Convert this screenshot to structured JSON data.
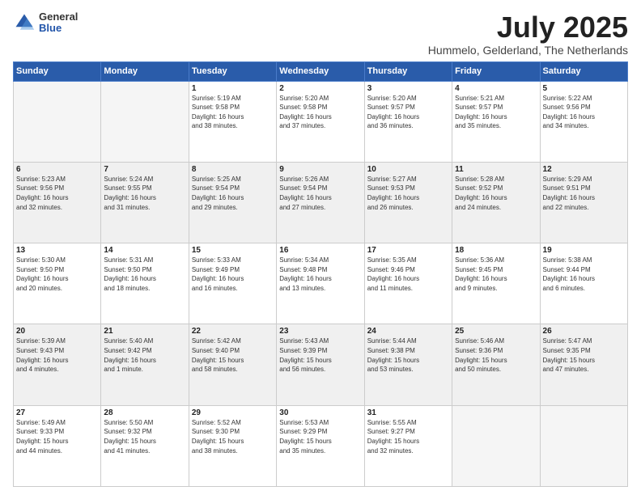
{
  "logo": {
    "general": "General",
    "blue": "Blue"
  },
  "title": "July 2025",
  "subtitle": "Hummelo, Gelderland, The Netherlands",
  "headers": [
    "Sunday",
    "Monday",
    "Tuesday",
    "Wednesday",
    "Thursday",
    "Friday",
    "Saturday"
  ],
  "weeks": [
    [
      {
        "day": "",
        "info": "",
        "empty": true
      },
      {
        "day": "",
        "info": "",
        "empty": true
      },
      {
        "day": "1",
        "info": "Sunrise: 5:19 AM\nSunset: 9:58 PM\nDaylight: 16 hours\nand 38 minutes."
      },
      {
        "day": "2",
        "info": "Sunrise: 5:20 AM\nSunset: 9:58 PM\nDaylight: 16 hours\nand 37 minutes."
      },
      {
        "day": "3",
        "info": "Sunrise: 5:20 AM\nSunset: 9:57 PM\nDaylight: 16 hours\nand 36 minutes."
      },
      {
        "day": "4",
        "info": "Sunrise: 5:21 AM\nSunset: 9:57 PM\nDaylight: 16 hours\nand 35 minutes."
      },
      {
        "day": "5",
        "info": "Sunrise: 5:22 AM\nSunset: 9:56 PM\nDaylight: 16 hours\nand 34 minutes."
      }
    ],
    [
      {
        "day": "6",
        "info": "Sunrise: 5:23 AM\nSunset: 9:56 PM\nDaylight: 16 hours\nand 32 minutes."
      },
      {
        "day": "7",
        "info": "Sunrise: 5:24 AM\nSunset: 9:55 PM\nDaylight: 16 hours\nand 31 minutes."
      },
      {
        "day": "8",
        "info": "Sunrise: 5:25 AM\nSunset: 9:54 PM\nDaylight: 16 hours\nand 29 minutes."
      },
      {
        "day": "9",
        "info": "Sunrise: 5:26 AM\nSunset: 9:54 PM\nDaylight: 16 hours\nand 27 minutes."
      },
      {
        "day": "10",
        "info": "Sunrise: 5:27 AM\nSunset: 9:53 PM\nDaylight: 16 hours\nand 26 minutes."
      },
      {
        "day": "11",
        "info": "Sunrise: 5:28 AM\nSunset: 9:52 PM\nDaylight: 16 hours\nand 24 minutes."
      },
      {
        "day": "12",
        "info": "Sunrise: 5:29 AM\nSunset: 9:51 PM\nDaylight: 16 hours\nand 22 minutes."
      }
    ],
    [
      {
        "day": "13",
        "info": "Sunrise: 5:30 AM\nSunset: 9:50 PM\nDaylight: 16 hours\nand 20 minutes."
      },
      {
        "day": "14",
        "info": "Sunrise: 5:31 AM\nSunset: 9:50 PM\nDaylight: 16 hours\nand 18 minutes."
      },
      {
        "day": "15",
        "info": "Sunrise: 5:33 AM\nSunset: 9:49 PM\nDaylight: 16 hours\nand 16 minutes."
      },
      {
        "day": "16",
        "info": "Sunrise: 5:34 AM\nSunset: 9:48 PM\nDaylight: 16 hours\nand 13 minutes."
      },
      {
        "day": "17",
        "info": "Sunrise: 5:35 AM\nSunset: 9:46 PM\nDaylight: 16 hours\nand 11 minutes."
      },
      {
        "day": "18",
        "info": "Sunrise: 5:36 AM\nSunset: 9:45 PM\nDaylight: 16 hours\nand 9 minutes."
      },
      {
        "day": "19",
        "info": "Sunrise: 5:38 AM\nSunset: 9:44 PM\nDaylight: 16 hours\nand 6 minutes."
      }
    ],
    [
      {
        "day": "20",
        "info": "Sunrise: 5:39 AM\nSunset: 9:43 PM\nDaylight: 16 hours\nand 4 minutes."
      },
      {
        "day": "21",
        "info": "Sunrise: 5:40 AM\nSunset: 9:42 PM\nDaylight: 16 hours\nand 1 minute."
      },
      {
        "day": "22",
        "info": "Sunrise: 5:42 AM\nSunset: 9:40 PM\nDaylight: 15 hours\nand 58 minutes."
      },
      {
        "day": "23",
        "info": "Sunrise: 5:43 AM\nSunset: 9:39 PM\nDaylight: 15 hours\nand 56 minutes."
      },
      {
        "day": "24",
        "info": "Sunrise: 5:44 AM\nSunset: 9:38 PM\nDaylight: 15 hours\nand 53 minutes."
      },
      {
        "day": "25",
        "info": "Sunrise: 5:46 AM\nSunset: 9:36 PM\nDaylight: 15 hours\nand 50 minutes."
      },
      {
        "day": "26",
        "info": "Sunrise: 5:47 AM\nSunset: 9:35 PM\nDaylight: 15 hours\nand 47 minutes."
      }
    ],
    [
      {
        "day": "27",
        "info": "Sunrise: 5:49 AM\nSunset: 9:33 PM\nDaylight: 15 hours\nand 44 minutes."
      },
      {
        "day": "28",
        "info": "Sunrise: 5:50 AM\nSunset: 9:32 PM\nDaylight: 15 hours\nand 41 minutes."
      },
      {
        "day": "29",
        "info": "Sunrise: 5:52 AM\nSunset: 9:30 PM\nDaylight: 15 hours\nand 38 minutes."
      },
      {
        "day": "30",
        "info": "Sunrise: 5:53 AM\nSunset: 9:29 PM\nDaylight: 15 hours\nand 35 minutes."
      },
      {
        "day": "31",
        "info": "Sunrise: 5:55 AM\nSunset: 9:27 PM\nDaylight: 15 hours\nand 32 minutes."
      },
      {
        "day": "",
        "info": "",
        "empty": true
      },
      {
        "day": "",
        "info": "",
        "empty": true
      }
    ]
  ]
}
